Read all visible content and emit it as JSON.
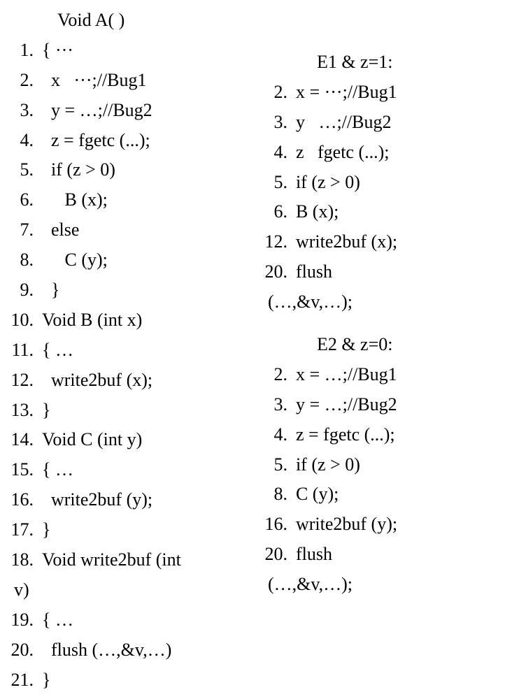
{
  "left": {
    "header": "Void A( )",
    "lines": [
      {
        "num": "1.",
        "code": "{ ···"
      },
      {
        "num": "2.",
        "code": "  x   ···;//Bug1"
      },
      {
        "num": "3.",
        "code": "  y = …;//Bug2"
      },
      {
        "num": "4.",
        "code": "  z = fgetc (...);"
      },
      {
        "num": "5.",
        "code": "  if (z > 0)"
      },
      {
        "num": "6.",
        "code": "     B (x);"
      },
      {
        "num": "7.",
        "code": "  else"
      },
      {
        "num": "8.",
        "code": "     C (y);"
      },
      {
        "num": "9.",
        "code": "  }"
      },
      {
        "num": "10.",
        "code": "Void B (int x)"
      },
      {
        "num": "11.",
        "code": "{ …"
      },
      {
        "num": "12.",
        "code": "  write2buf (x);"
      },
      {
        "num": "13.",
        "code": "}"
      },
      {
        "num": "14.",
        "code": "Void C (int y)"
      },
      {
        "num": "15.",
        "code": "{ …"
      },
      {
        "num": "16.",
        "code": "  write2buf (y);"
      },
      {
        "num": "17.",
        "code": "}"
      },
      {
        "num": "18.",
        "code": "Void write2buf (int"
      }
    ],
    "cont1": "v)",
    "lines2": [
      {
        "num": "19.",
        "code": "{ …"
      },
      {
        "num": "20.",
        "code": "  flush (…,&v,…)"
      },
      {
        "num": "21.",
        "code": "}"
      }
    ]
  },
  "right": {
    "block1": {
      "header": "E1 & z=1:",
      "lines": [
        {
          "num": "2.",
          "code": "x = ···;//Bug1"
        },
        {
          "num": "3.",
          "code": "y   …;//Bug2"
        },
        {
          "num": "4.",
          "code": "z   fgetc (...);"
        },
        {
          "num": "5.",
          "code": "if (z > 0)"
        },
        {
          "num": "6.",
          "code": "B (x);"
        },
        {
          "num": "12.",
          "code": "write2buf (x);"
        },
        {
          "num": "20.",
          "code": "flush"
        }
      ],
      "cont": "(…,&v,…);"
    },
    "block2": {
      "header": "E2 & z=0:",
      "lines": [
        {
          "num": "2.",
          "code": "x = …;//Bug1"
        },
        {
          "num": "3.",
          "code": "y = …;//Bug2"
        },
        {
          "num": "4.",
          "code": "z = fgetc (...);"
        },
        {
          "num": "5.",
          "code": "if (z > 0)"
        },
        {
          "num": "8.",
          "code": "C (y);"
        },
        {
          "num": "16.",
          "code": "write2buf (y);"
        },
        {
          "num": "20.",
          "code": "flush"
        }
      ],
      "cont": "(…,&v,…);"
    }
  }
}
